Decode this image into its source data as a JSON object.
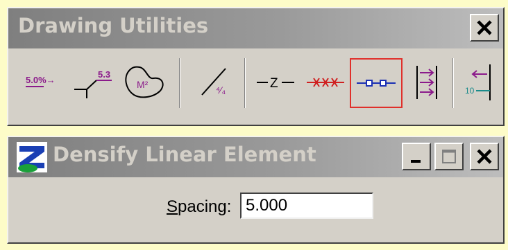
{
  "drawing_utilities": {
    "title": "Drawing Utilities",
    "tools": [
      {
        "name": "slope-annotation-tool",
        "label": "5.0%→"
      },
      {
        "name": "elevation-annotation-tool",
        "label": "5.3"
      },
      {
        "name": "area-annotation-tool",
        "label": "M²"
      },
      {
        "name": "ratio-line-tool",
        "label": "⁴⁄₄"
      },
      {
        "name": "z-line-tool",
        "label": "Z"
      },
      {
        "name": "cross-line-tool"
      },
      {
        "name": "densify-linear-element-tool"
      },
      {
        "name": "arrow-lines-tool"
      },
      {
        "name": "station-offset-tool",
        "label": "10"
      }
    ]
  },
  "densify_dialog": {
    "title": "Densify Linear Element",
    "spacing_label_mnemonic": "S",
    "spacing_label_rest": "pacing:",
    "spacing_value": "5.000"
  },
  "colors": {
    "background": "#fdfcc8",
    "tool_purple": "#8b1a8b",
    "tool_red": "#d02020",
    "tool_blue": "#1a2fb4",
    "active_border": "#e0302b"
  }
}
